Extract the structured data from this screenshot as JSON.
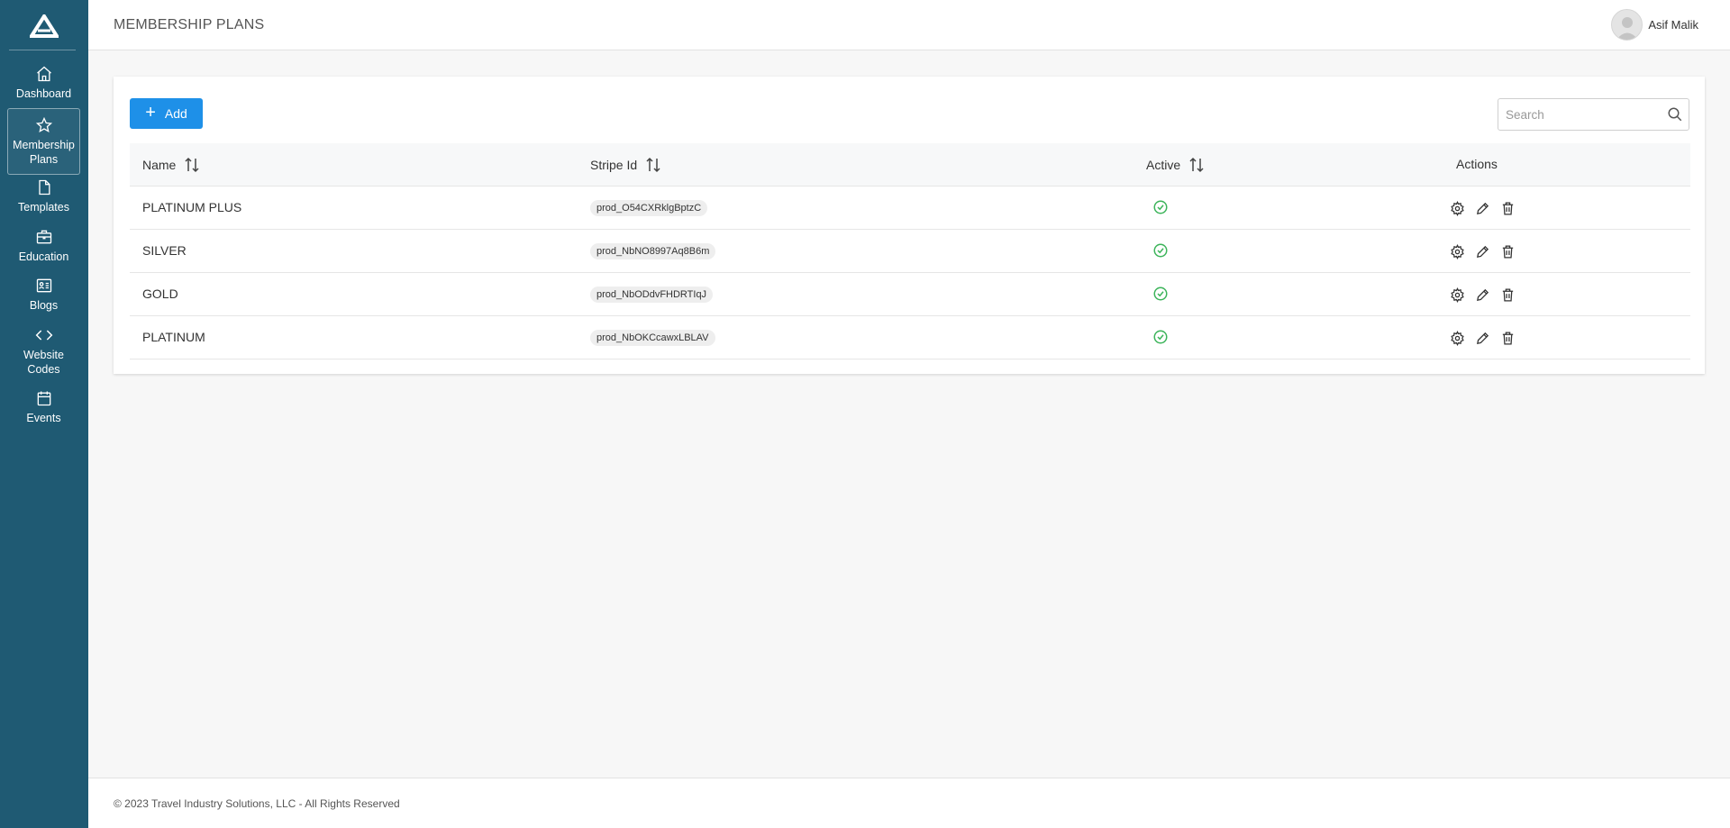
{
  "sidebar": {
    "items": [
      {
        "label": "Dashboard",
        "icon": "home-icon"
      },
      {
        "label": "Membership Plans",
        "icon": "star-icon",
        "active": true
      },
      {
        "label": "Templates",
        "icon": "file-icon"
      },
      {
        "label": "Education",
        "icon": "briefcase-icon"
      },
      {
        "label": "Blogs",
        "icon": "news-icon"
      },
      {
        "label": "Website Codes",
        "icon": "code-icon"
      },
      {
        "label": "Events",
        "icon": "calendar-icon"
      }
    ]
  },
  "header": {
    "title": "MEMBERSHIP PLANS",
    "user_name": "Asif Malik"
  },
  "toolbar": {
    "add_label": "Add",
    "search_placeholder": "Search"
  },
  "table": {
    "columns": {
      "name": "Name",
      "stripe_id": "Stripe Id",
      "active": "Active",
      "actions": "Actions"
    },
    "rows": [
      {
        "name": "PLATINUM PLUS",
        "stripe_id": "prod_O54CXRklgBptzC",
        "active": true
      },
      {
        "name": "SILVER",
        "stripe_id": "prod_NbNO8997Aq8B6m",
        "active": true
      },
      {
        "name": "GOLD",
        "stripe_id": "prod_NbODdvFHDRTIqJ",
        "active": true
      },
      {
        "name": "PLATINUM",
        "stripe_id": "prod_NbOKCcawxLBLAV",
        "active": true
      }
    ]
  },
  "footer": {
    "copyright": "© 2023 Travel Industry Solutions, LLC - All Rights Reserved"
  },
  "colors": {
    "sidebar": "#1f5a73",
    "primary_button": "#1e90e8",
    "active_check": "#3cb45a"
  }
}
